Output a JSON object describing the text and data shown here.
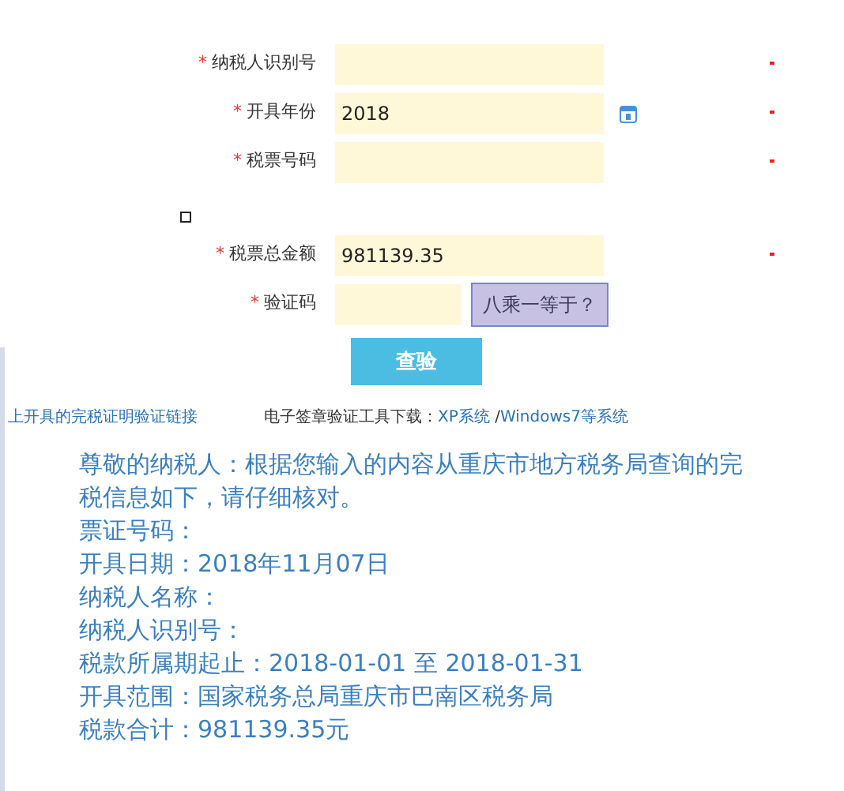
{
  "form": {
    "fields": [
      {
        "label": "纳税人识别号",
        "marker": "*",
        "flagged": true,
        "kind": "text"
      },
      {
        "label": "开具年份",
        "marker": "*",
        "value": "2018",
        "flagged": true,
        "calendar": true,
        "kind": "text"
      },
      {
        "label": "税票号码",
        "marker": "*",
        "flagged": true,
        "kind": "text"
      },
      {
        "label": "税票总金额",
        "marker": "*",
        "value": "981139.35",
        "flagged": true,
        "kind": "text",
        "checkbox": {
          "checked": false
        }
      },
      {
        "label": "验证码",
        "marker": "*",
        "kind": "captcha",
        "captcha": "八乘一等于？"
      }
    ],
    "submit": "查验"
  },
  "links": {
    "left": "上开具的完税证明验证链接",
    "tool_label": "电子签章验证工具下载：",
    "tool_links": [
      "XP系统",
      "Windows7等系统"
    ],
    "separator": " /"
  },
  "result": {
    "intro": "尊敬的纳税人：根据您输入的内容从重庆市地方税务局查询的完税信息如下，请仔细核对。",
    "lines": [
      "票证号码：",
      "开具日期：2018年11月07日",
      "纳税人名称：",
      "纳税人识别号：",
      "税款所属期起止：2018-01-01 至 2018-01-31",
      "开具范围：国家税务总局重庆市巴南区税务局",
      "税款合计：981139.35元"
    ]
  }
}
